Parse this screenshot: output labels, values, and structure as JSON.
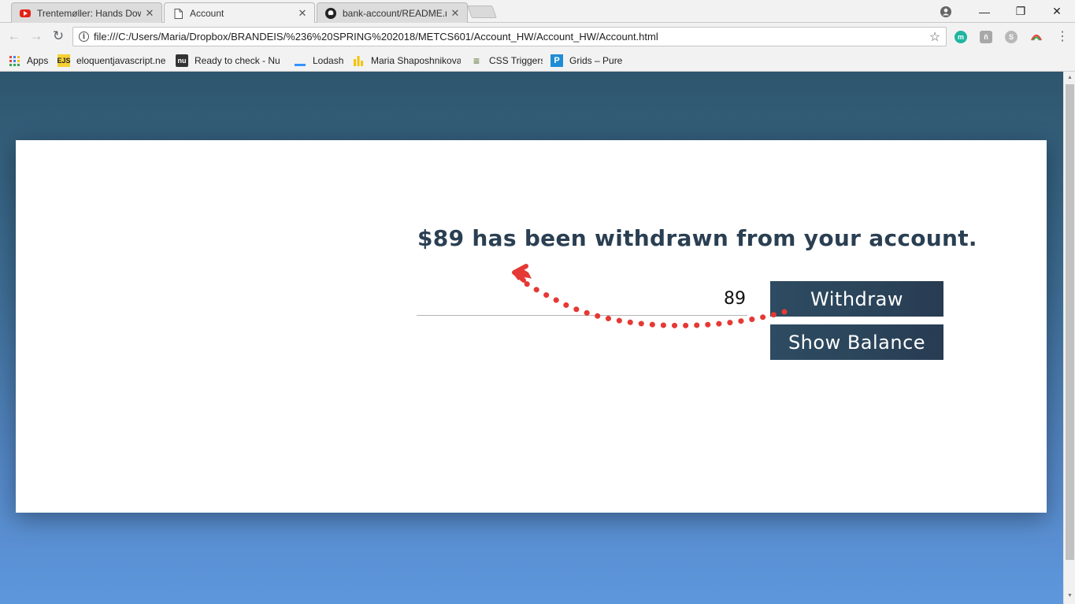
{
  "browser": {
    "tabs": [
      {
        "title": "Trentemøller: Hands Dow",
        "icon": "youtube-icon",
        "active": false
      },
      {
        "title": "Account",
        "icon": "document-icon",
        "active": true
      },
      {
        "title": "bank-account/README.m",
        "icon": "github-icon",
        "active": false
      }
    ],
    "close_glyph": "✕",
    "window_controls": {
      "minimize": "—",
      "restore": "❐",
      "close": "✕"
    },
    "url": "file:///C:/Users/Maria/Dropbox/BRANDEIS/%236%20SPRING%202018/METCS601/Account_HW/Account_HW/Account.html",
    "extensions": [
      {
        "icon": "m-extension-icon",
        "letter": "m",
        "color": "#1fb5a0"
      },
      {
        "icon": "puzzle-extension-icon",
        "letter": "ñ",
        "color": "#9a9a9a"
      },
      {
        "icon": "skype-extension-icon",
        "letter": "S",
        "color": "#b0b0b0"
      },
      {
        "icon": "arc-extension-icon",
        "letter": "",
        "color": "#ffffff"
      }
    ],
    "bookmarks": [
      {
        "label": "Apps",
        "icon": "apps-grid-icon"
      },
      {
        "label": "eloquentjavascript.ne",
        "icon": "ejs-icon",
        "badge": "EJS",
        "color": "#f5d033"
      },
      {
        "label": "Ready to check - Nu L",
        "icon": "nu-icon",
        "badge": "nu",
        "color": "#333333"
      },
      {
        "label": "Lodash",
        "icon": "lodash-icon",
        "badge": "",
        "color": "#3492ff"
      },
      {
        "label": "Maria Shaposhnikova",
        "icon": "bars-icon",
        "badge": "",
        "color": "#f5c400"
      },
      {
        "label": "CSS Triggers",
        "icon": "css-triggers-icon",
        "badge": "≡",
        "color": "#4f6b2e"
      },
      {
        "label": "Grids – Pure",
        "icon": "pure-icon",
        "badge": "P",
        "color": "#1f8dd6"
      }
    ]
  },
  "page": {
    "message": "$89 has been withdrawn from your account.",
    "amount_value": "89",
    "withdraw_label": "Withdraw",
    "show_balance_label": "Show Balance",
    "annotation_color": "#e53935"
  }
}
